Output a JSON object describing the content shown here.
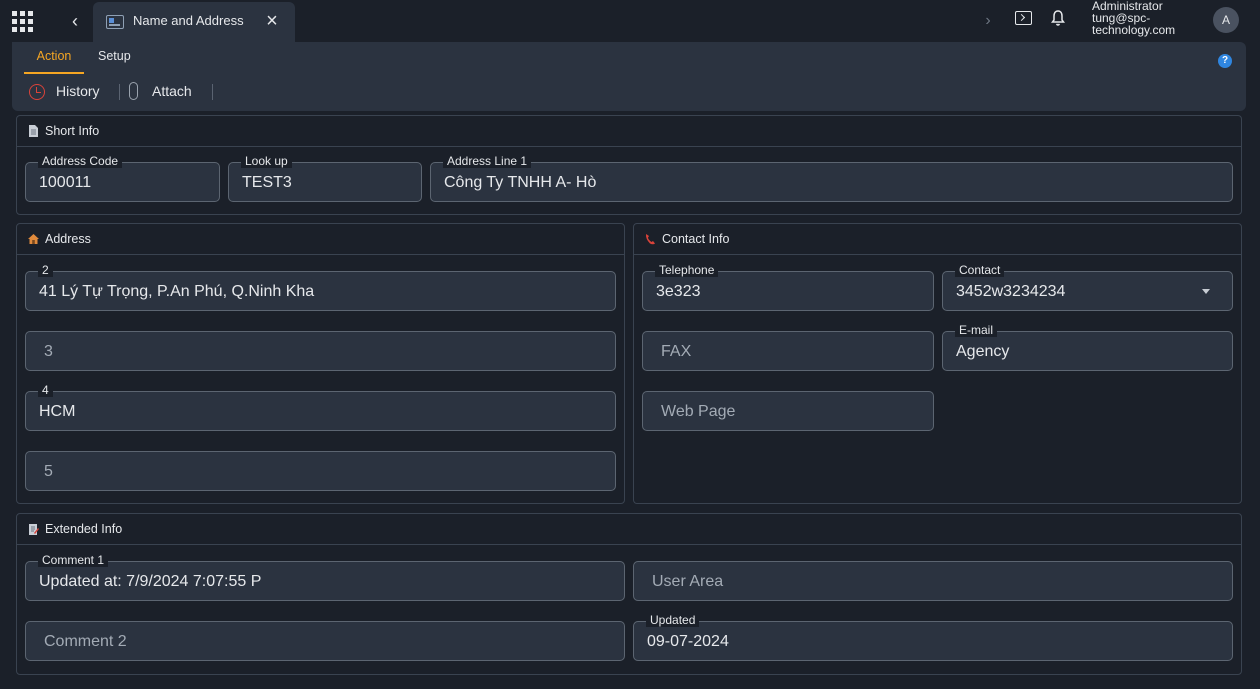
{
  "header": {
    "tab_title": "Name and Address",
    "user_role": "Administrator",
    "user_email_line1": "tung@spc-",
    "user_email_line2": "technology.com",
    "avatar_initial": "A"
  },
  "toolbar": {
    "tabs": [
      {
        "label": "Action",
        "active": true
      },
      {
        "label": "Setup",
        "active": false
      }
    ],
    "history_label": "History",
    "attach_label": "Attach",
    "help_symbol": "?"
  },
  "sections": {
    "short_info": {
      "title": "Short Info",
      "fields": {
        "address_code": {
          "label": "Address Code",
          "value": "100011"
        },
        "look_up": {
          "label": "Look up",
          "value": "TEST3"
        },
        "address_line_1": {
          "label": "Address Line 1",
          "value": "Công Ty TNHH A- Hò"
        }
      }
    },
    "address": {
      "title": "Address",
      "fields": {
        "line2": {
          "label": "2",
          "value": "41 Lý Tự Trọng, P.An Phú, Q.Ninh Kha"
        },
        "line3": {
          "placeholder": "3"
        },
        "line4": {
          "label": "4",
          "value": "HCM"
        },
        "line5": {
          "placeholder": "5"
        }
      }
    },
    "contact_info": {
      "title": "Contact Info",
      "fields": {
        "telephone": {
          "label": "Telephone",
          "value": "3e323"
        },
        "contact": {
          "label": "Contact",
          "value": "3452w3234234"
        },
        "fax": {
          "placeholder": "FAX"
        },
        "email": {
          "label": "E-mail",
          "value": "Agency"
        },
        "web_page": {
          "placeholder": "Web Page"
        }
      }
    },
    "extended_info": {
      "title": "Extended Info",
      "fields": {
        "comment1": {
          "label": "Comment 1",
          "value": "Updated at: 7/9/2024 7:07:55 P"
        },
        "user_area": {
          "placeholder": "User Area"
        },
        "comment2": {
          "placeholder": "Comment 2"
        },
        "updated": {
          "label": "Updated",
          "value": "09-07-2024"
        }
      }
    }
  },
  "colors": {
    "background": "#1b2029",
    "panel": "#2b3340",
    "accent": "#f5a623",
    "history_icon": "#d9433a",
    "help_icon": "#2f86e0"
  },
  "icons": [
    "apps-grid-icon",
    "chevron-left-icon",
    "window-icon",
    "close-icon",
    "chevron-right-icon",
    "console-icon",
    "bell-icon",
    "help-icon",
    "history-icon",
    "paperclip-icon",
    "document-icon",
    "house-icon",
    "phone-icon",
    "notepad-icon",
    "dropdown-caret-icon"
  ]
}
